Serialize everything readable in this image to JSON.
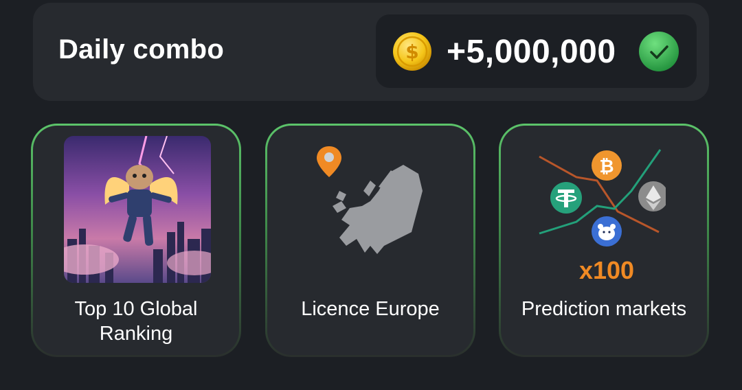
{
  "header": {
    "title": "Daily combo",
    "reward": "+5,000,000",
    "coin_icon": "gold-dollar-coin-icon",
    "status_icon": "green-checkmark-icon",
    "colors": {
      "panel": "#272a2f",
      "background": "#1c1f24",
      "coin": "#f5c518",
      "check": "#2ea84a",
      "card_border": "#5cc46a"
    }
  },
  "cards": [
    {
      "label": "Top 10 Global Ranking",
      "image": "flying-hamster-astronaut-image"
    },
    {
      "label": "Licence Europe",
      "image": "europe-map-with-location-pin"
    },
    {
      "label": "Prediction markets",
      "image": "crypto-coins-chart",
      "multiplier": "x100"
    }
  ]
}
